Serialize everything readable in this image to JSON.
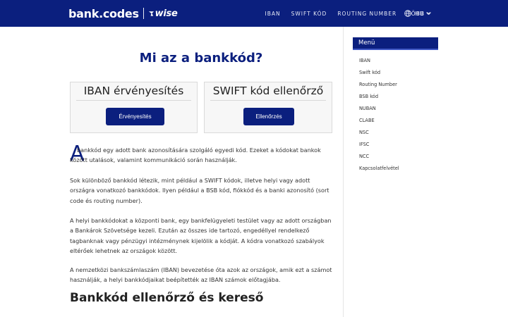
{
  "header": {
    "logo_bank": "bank.codes",
    "logo_wise": "wise",
    "nav": [
      "IBAN",
      "SWIFT KÓD",
      "ROUTING NUMBER",
      "TÖBB"
    ],
    "language": "HU"
  },
  "main": {
    "title": "Mi az a bankkód?",
    "tools": [
      {
        "title": "IBAN érvényesítés",
        "button": "Érvényesítés"
      },
      {
        "title": "SWIFT kód ellenőrző",
        "button": "Ellenőrzés"
      }
    ],
    "dropcap": "A",
    "para1_line1": "bankkód egy adott bank azonosítására szolgáló egyedi kód. Ezeket a kódokat bankok",
    "para1_line2": "között utalások, valamint kommunikáció során használják.",
    "para2": "Sok különböző bankkód létezik, mint például a SWIFT kódok, illetve helyi vagy adott országra vonatkozó bankkódok. Ilyen például a BSB kód, fiókkód és a banki azonosító (sort code és routing number).",
    "para3": "A helyi bankkódokat a központi bank, egy bankfelügyeleti testület vagy az adott országban a Bankárok Szövetsége kezeli. Ezután az összes ide tartozó, engedéllyel rendelkező tagbanknak vagy pénzügyi intézménynek kijelölik a kódját. A kódra vonatkozó szabályok eltérőek lehetnek az országok között.",
    "para4": "A nemzetközi bankszámlaszám (IBAN) bevezetése óta azok az országok, amik ezt a számot használják, a helyi bankkódjaikat beépítették az IBAN számok előtagjába.",
    "section_title": "Bankkód ellenőrző és kereső"
  },
  "sidebar": {
    "heading": "Menü",
    "items": [
      "IBAN",
      "Swift kód",
      "Routing Number",
      "BSB kód",
      "NUBAN",
      "CLABE",
      "NSC",
      "IFSC",
      "NCC",
      "Kapcsolatfelvétel"
    ]
  },
  "colors": {
    "brand": "#0b1f7e",
    "background": "#ffffff"
  }
}
